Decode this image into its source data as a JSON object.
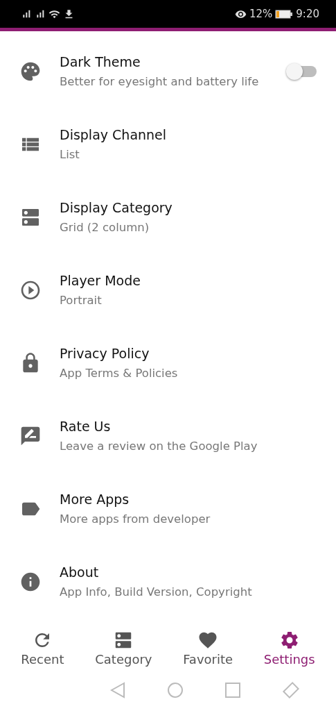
{
  "status_bar": {
    "battery": "12%",
    "time": "9:20"
  },
  "settings": [
    {
      "kind": "toggle",
      "title": "Dark Theme",
      "subtitle": "Better for eyesight and battery life",
      "on": false
    },
    {
      "kind": "plain",
      "title": "Display Channel",
      "subtitle": "List"
    },
    {
      "kind": "plain",
      "title": "Display Category",
      "subtitle": "Grid (2 column)"
    },
    {
      "kind": "plain",
      "title": "Player Mode",
      "subtitle": "Portrait"
    },
    {
      "kind": "plain",
      "title": "Privacy Policy",
      "subtitle": "App Terms & Policies"
    },
    {
      "kind": "plain",
      "title": "Rate Us",
      "subtitle": "Leave a review on the Google Play"
    },
    {
      "kind": "plain",
      "title": "More Apps",
      "subtitle": "More apps from developer"
    },
    {
      "kind": "plain",
      "title": "About",
      "subtitle": "App Info, Build Version, Copyright"
    }
  ],
  "bottom_nav": [
    {
      "label": "Recent",
      "selected": false
    },
    {
      "label": "Category",
      "selected": false
    },
    {
      "label": "Favorite",
      "selected": false
    },
    {
      "label": "Settings",
      "selected": true
    }
  ]
}
